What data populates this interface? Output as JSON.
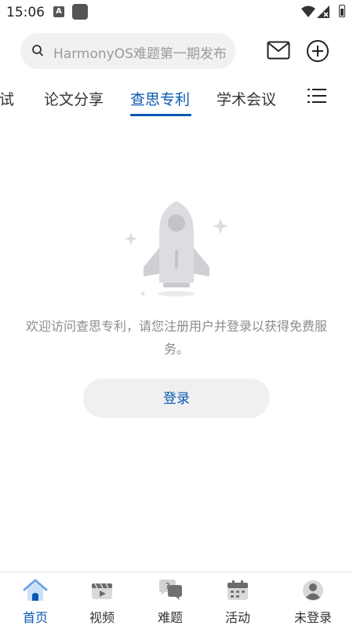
{
  "status_bar": {
    "time": "15:06"
  },
  "search": {
    "placeholder": "HarmonyOS难题第一期发布"
  },
  "header": {
    "mail_icon": "mail-icon",
    "add_icon": "plus-circle-icon"
  },
  "tabs": [
    {
      "label": "试"
    },
    {
      "label": "论文分享"
    },
    {
      "label": "查思专利"
    },
    {
      "label": "学术会议"
    }
  ],
  "active_tab": "查思专利",
  "empty_state": {
    "illustration": "rocket-icon",
    "message": "欢迎访问查思专利，请您注册用户并登录以获得免费服务。",
    "login_label": "登录"
  },
  "bottom_nav": [
    {
      "label": "首页",
      "icon": "home-icon"
    },
    {
      "label": "视频",
      "icon": "video-icon"
    },
    {
      "label": "难题",
      "icon": "question-chat-icon"
    },
    {
      "label": "活动",
      "icon": "calendar-icon"
    },
    {
      "label": "未登录",
      "icon": "user-icon"
    }
  ],
  "colors": {
    "accent": "#0a58b3",
    "muted": "#8c8c8c",
    "search_bg": "#f1f1f1"
  }
}
